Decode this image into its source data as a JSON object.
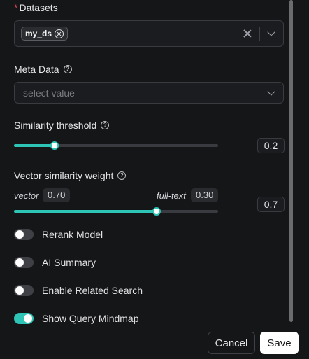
{
  "datasets": {
    "required_mark": "*",
    "label": "Datasets",
    "selected_tags": [
      "my_ds"
    ]
  },
  "meta_data": {
    "label": "Meta Data",
    "placeholder": "select value"
  },
  "similarity_threshold": {
    "label": "Similarity threshold",
    "value_text": "0.2",
    "slider_fraction": 0.2
  },
  "vector_similarity_weight": {
    "label": "Vector similarity weight",
    "vector_label": "vector",
    "vector_value": "0.70",
    "fulltext_label": "full-text",
    "fulltext_value": "0.30",
    "value_text": "0.7",
    "slider_fraction": 0.7
  },
  "toggles": [
    {
      "label": "Rerank Model",
      "on": false
    },
    {
      "label": "AI Summary",
      "on": false
    },
    {
      "label": "Enable Related Search",
      "on": false
    },
    {
      "label": "Show Query Mindmap",
      "on": true
    }
  ],
  "buttons": {
    "cancel": "Cancel",
    "save": "Save"
  },
  "colors": {
    "accent": "#2ec4b6",
    "required": "#e5484d",
    "background": "#151618"
  },
  "icons": {
    "help": "question-circle-icon",
    "tag_remove": "close-circle-icon",
    "clear": "close-icon",
    "dropdown": "chevron-down-icon"
  }
}
